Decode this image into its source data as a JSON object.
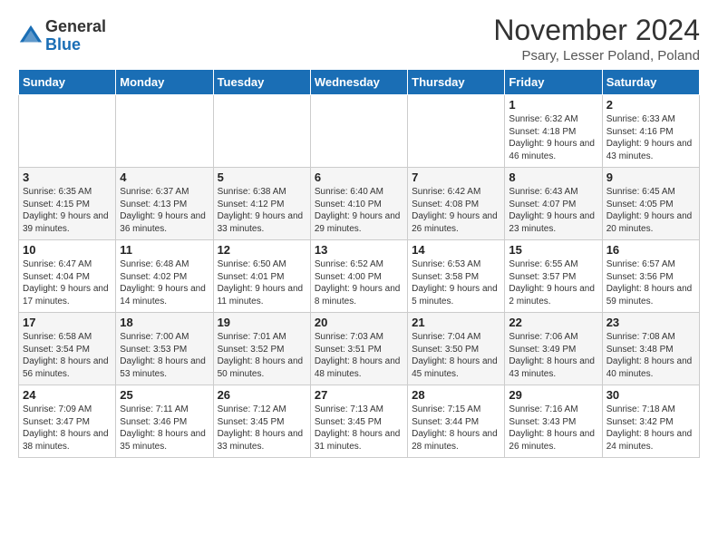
{
  "logo": {
    "general": "General",
    "blue": "Blue"
  },
  "title": "November 2024",
  "subtitle": "Psary, Lesser Poland, Poland",
  "days_of_week": [
    "Sunday",
    "Monday",
    "Tuesday",
    "Wednesday",
    "Thursday",
    "Friday",
    "Saturday"
  ],
  "weeks": [
    [
      {
        "day": "",
        "detail": ""
      },
      {
        "day": "",
        "detail": ""
      },
      {
        "day": "",
        "detail": ""
      },
      {
        "day": "",
        "detail": ""
      },
      {
        "day": "",
        "detail": ""
      },
      {
        "day": "1",
        "detail": "Sunrise: 6:32 AM\nSunset: 4:18 PM\nDaylight: 9 hours\nand 46 minutes."
      },
      {
        "day": "2",
        "detail": "Sunrise: 6:33 AM\nSunset: 4:16 PM\nDaylight: 9 hours\nand 43 minutes."
      }
    ],
    [
      {
        "day": "3",
        "detail": "Sunrise: 6:35 AM\nSunset: 4:15 PM\nDaylight: 9 hours\nand 39 minutes."
      },
      {
        "day": "4",
        "detail": "Sunrise: 6:37 AM\nSunset: 4:13 PM\nDaylight: 9 hours\nand 36 minutes."
      },
      {
        "day": "5",
        "detail": "Sunrise: 6:38 AM\nSunset: 4:12 PM\nDaylight: 9 hours\nand 33 minutes."
      },
      {
        "day": "6",
        "detail": "Sunrise: 6:40 AM\nSunset: 4:10 PM\nDaylight: 9 hours\nand 29 minutes."
      },
      {
        "day": "7",
        "detail": "Sunrise: 6:42 AM\nSunset: 4:08 PM\nDaylight: 9 hours\nand 26 minutes."
      },
      {
        "day": "8",
        "detail": "Sunrise: 6:43 AM\nSunset: 4:07 PM\nDaylight: 9 hours\nand 23 minutes."
      },
      {
        "day": "9",
        "detail": "Sunrise: 6:45 AM\nSunset: 4:05 PM\nDaylight: 9 hours\nand 20 minutes."
      }
    ],
    [
      {
        "day": "10",
        "detail": "Sunrise: 6:47 AM\nSunset: 4:04 PM\nDaylight: 9 hours\nand 17 minutes."
      },
      {
        "day": "11",
        "detail": "Sunrise: 6:48 AM\nSunset: 4:02 PM\nDaylight: 9 hours\nand 14 minutes."
      },
      {
        "day": "12",
        "detail": "Sunrise: 6:50 AM\nSunset: 4:01 PM\nDaylight: 9 hours\nand 11 minutes."
      },
      {
        "day": "13",
        "detail": "Sunrise: 6:52 AM\nSunset: 4:00 PM\nDaylight: 9 hours\nand 8 minutes."
      },
      {
        "day": "14",
        "detail": "Sunrise: 6:53 AM\nSunset: 3:58 PM\nDaylight: 9 hours\nand 5 minutes."
      },
      {
        "day": "15",
        "detail": "Sunrise: 6:55 AM\nSunset: 3:57 PM\nDaylight: 9 hours\nand 2 minutes."
      },
      {
        "day": "16",
        "detail": "Sunrise: 6:57 AM\nSunset: 3:56 PM\nDaylight: 8 hours\nand 59 minutes."
      }
    ],
    [
      {
        "day": "17",
        "detail": "Sunrise: 6:58 AM\nSunset: 3:54 PM\nDaylight: 8 hours\nand 56 minutes."
      },
      {
        "day": "18",
        "detail": "Sunrise: 7:00 AM\nSunset: 3:53 PM\nDaylight: 8 hours\nand 53 minutes."
      },
      {
        "day": "19",
        "detail": "Sunrise: 7:01 AM\nSunset: 3:52 PM\nDaylight: 8 hours\nand 50 minutes."
      },
      {
        "day": "20",
        "detail": "Sunrise: 7:03 AM\nSunset: 3:51 PM\nDaylight: 8 hours\nand 48 minutes."
      },
      {
        "day": "21",
        "detail": "Sunrise: 7:04 AM\nSunset: 3:50 PM\nDaylight: 8 hours\nand 45 minutes."
      },
      {
        "day": "22",
        "detail": "Sunrise: 7:06 AM\nSunset: 3:49 PM\nDaylight: 8 hours\nand 43 minutes."
      },
      {
        "day": "23",
        "detail": "Sunrise: 7:08 AM\nSunset: 3:48 PM\nDaylight: 8 hours\nand 40 minutes."
      }
    ],
    [
      {
        "day": "24",
        "detail": "Sunrise: 7:09 AM\nSunset: 3:47 PM\nDaylight: 8 hours\nand 38 minutes."
      },
      {
        "day": "25",
        "detail": "Sunrise: 7:11 AM\nSunset: 3:46 PM\nDaylight: 8 hours\nand 35 minutes."
      },
      {
        "day": "26",
        "detail": "Sunrise: 7:12 AM\nSunset: 3:45 PM\nDaylight: 8 hours\nand 33 minutes."
      },
      {
        "day": "27",
        "detail": "Sunrise: 7:13 AM\nSunset: 3:45 PM\nDaylight: 8 hours\nand 31 minutes."
      },
      {
        "day": "28",
        "detail": "Sunrise: 7:15 AM\nSunset: 3:44 PM\nDaylight: 8 hours\nand 28 minutes."
      },
      {
        "day": "29",
        "detail": "Sunrise: 7:16 AM\nSunset: 3:43 PM\nDaylight: 8 hours\nand 26 minutes."
      },
      {
        "day": "30",
        "detail": "Sunrise: 7:18 AM\nSunset: 3:42 PM\nDaylight: 8 hours\nand 24 minutes."
      }
    ]
  ]
}
